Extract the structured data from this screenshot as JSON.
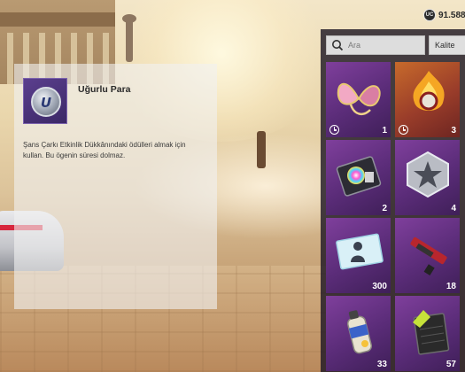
{
  "currency": {
    "icon": "currency-coin-icon",
    "value": "91.588"
  },
  "search": {
    "placeholder": "Ara"
  },
  "filter": {
    "label": "Kalite"
  },
  "detail": {
    "title": "Uğurlu Para",
    "description": "Şans Çarkı Etkinlik Dükkânındaki ödülleri almak için kullan. Bu ögenin süresi dolmaz.",
    "icon": "lucky-coin-icon"
  },
  "inventory": {
    "items": [
      {
        "name": "pink-angel-wings-icon",
        "count": "1",
        "timer": true
      },
      {
        "name": "flame-emblem-icon",
        "count": "3",
        "timer": true
      },
      {
        "name": "color-paint-kit-icon",
        "count": "2",
        "timer": false
      },
      {
        "name": "silver-star-badge-icon",
        "count": "4",
        "timer": false
      },
      {
        "name": "outfit-voucher-icon",
        "count": "300",
        "timer": false
      },
      {
        "name": "weapon-skin-icon",
        "count": "18",
        "timer": false
      },
      {
        "name": "spray-can-icon",
        "count": "33",
        "timer": false
      },
      {
        "name": "green-tag-card-icon",
        "count": "57",
        "timer": false
      }
    ]
  }
}
